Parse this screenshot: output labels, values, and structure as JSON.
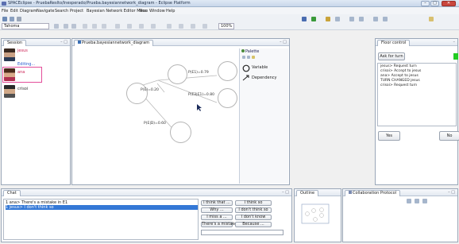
{
  "window": {
    "title": "SPACEclipse - PruebaReslto/Inesperado/Prueba.bayesiannetwork_diagram - Eclipse Platform"
  },
  "menu": [
    "File",
    "Edit",
    "Diagram",
    "Navigate",
    "Search",
    "Project",
    "Bayesian Network Editor Menu",
    "Run",
    "Window",
    "Help"
  ],
  "toolbar": {
    "font": "Tahoma",
    "zoom": "100%"
  },
  "session": {
    "tab": "Session",
    "users": [
      {
        "name": "jesus",
        "status": "Editing..."
      },
      {
        "name": "ana",
        "status": ""
      },
      {
        "name": "crisoi",
        "status": ""
      }
    ]
  },
  "diagram": {
    "tab": "Prueba.bayesiannetwork_diagram",
    "nodes": [
      {
        "label": "P(E1)=0.79"
      },
      {
        "label": "P(E)=0.20"
      },
      {
        "label": "P(E2|E1)=0.80"
      },
      {
        "label": "P(E|D)=0.60"
      }
    ]
  },
  "palette": {
    "title": "Palette",
    "items": [
      {
        "label": "Variable"
      },
      {
        "label": "Dependency"
      }
    ]
  },
  "floor": {
    "tab": "Floor control",
    "ask_button": "Ask for turn",
    "log": [
      "jesus> Request turn",
      "crisoi> Accept to jesus",
      "ana> Accept to jesus",
      "TURN CHANGED jesus",
      "crisoi> Request turn"
    ],
    "yes": "Yes",
    "no": "No",
    "accent": "#22cc22"
  },
  "chat": {
    "tab": "Chat",
    "messages": [
      {
        "text": "1 ana> There's a mistake in E1"
      },
      {
        "text": "1 jesus> I don't think so"
      }
    ],
    "quick_buttons": [
      [
        "I think that ...",
        "I think so"
      ],
      [
        "Why ...",
        "I don't think so"
      ],
      [
        "I miss a ...",
        "I don't know"
      ],
      [
        "There's a mistake in ...",
        "Because ..."
      ]
    ]
  },
  "outline": {
    "tab": "Outline"
  },
  "collab": {
    "tab": "Collaboration Protocol"
  }
}
